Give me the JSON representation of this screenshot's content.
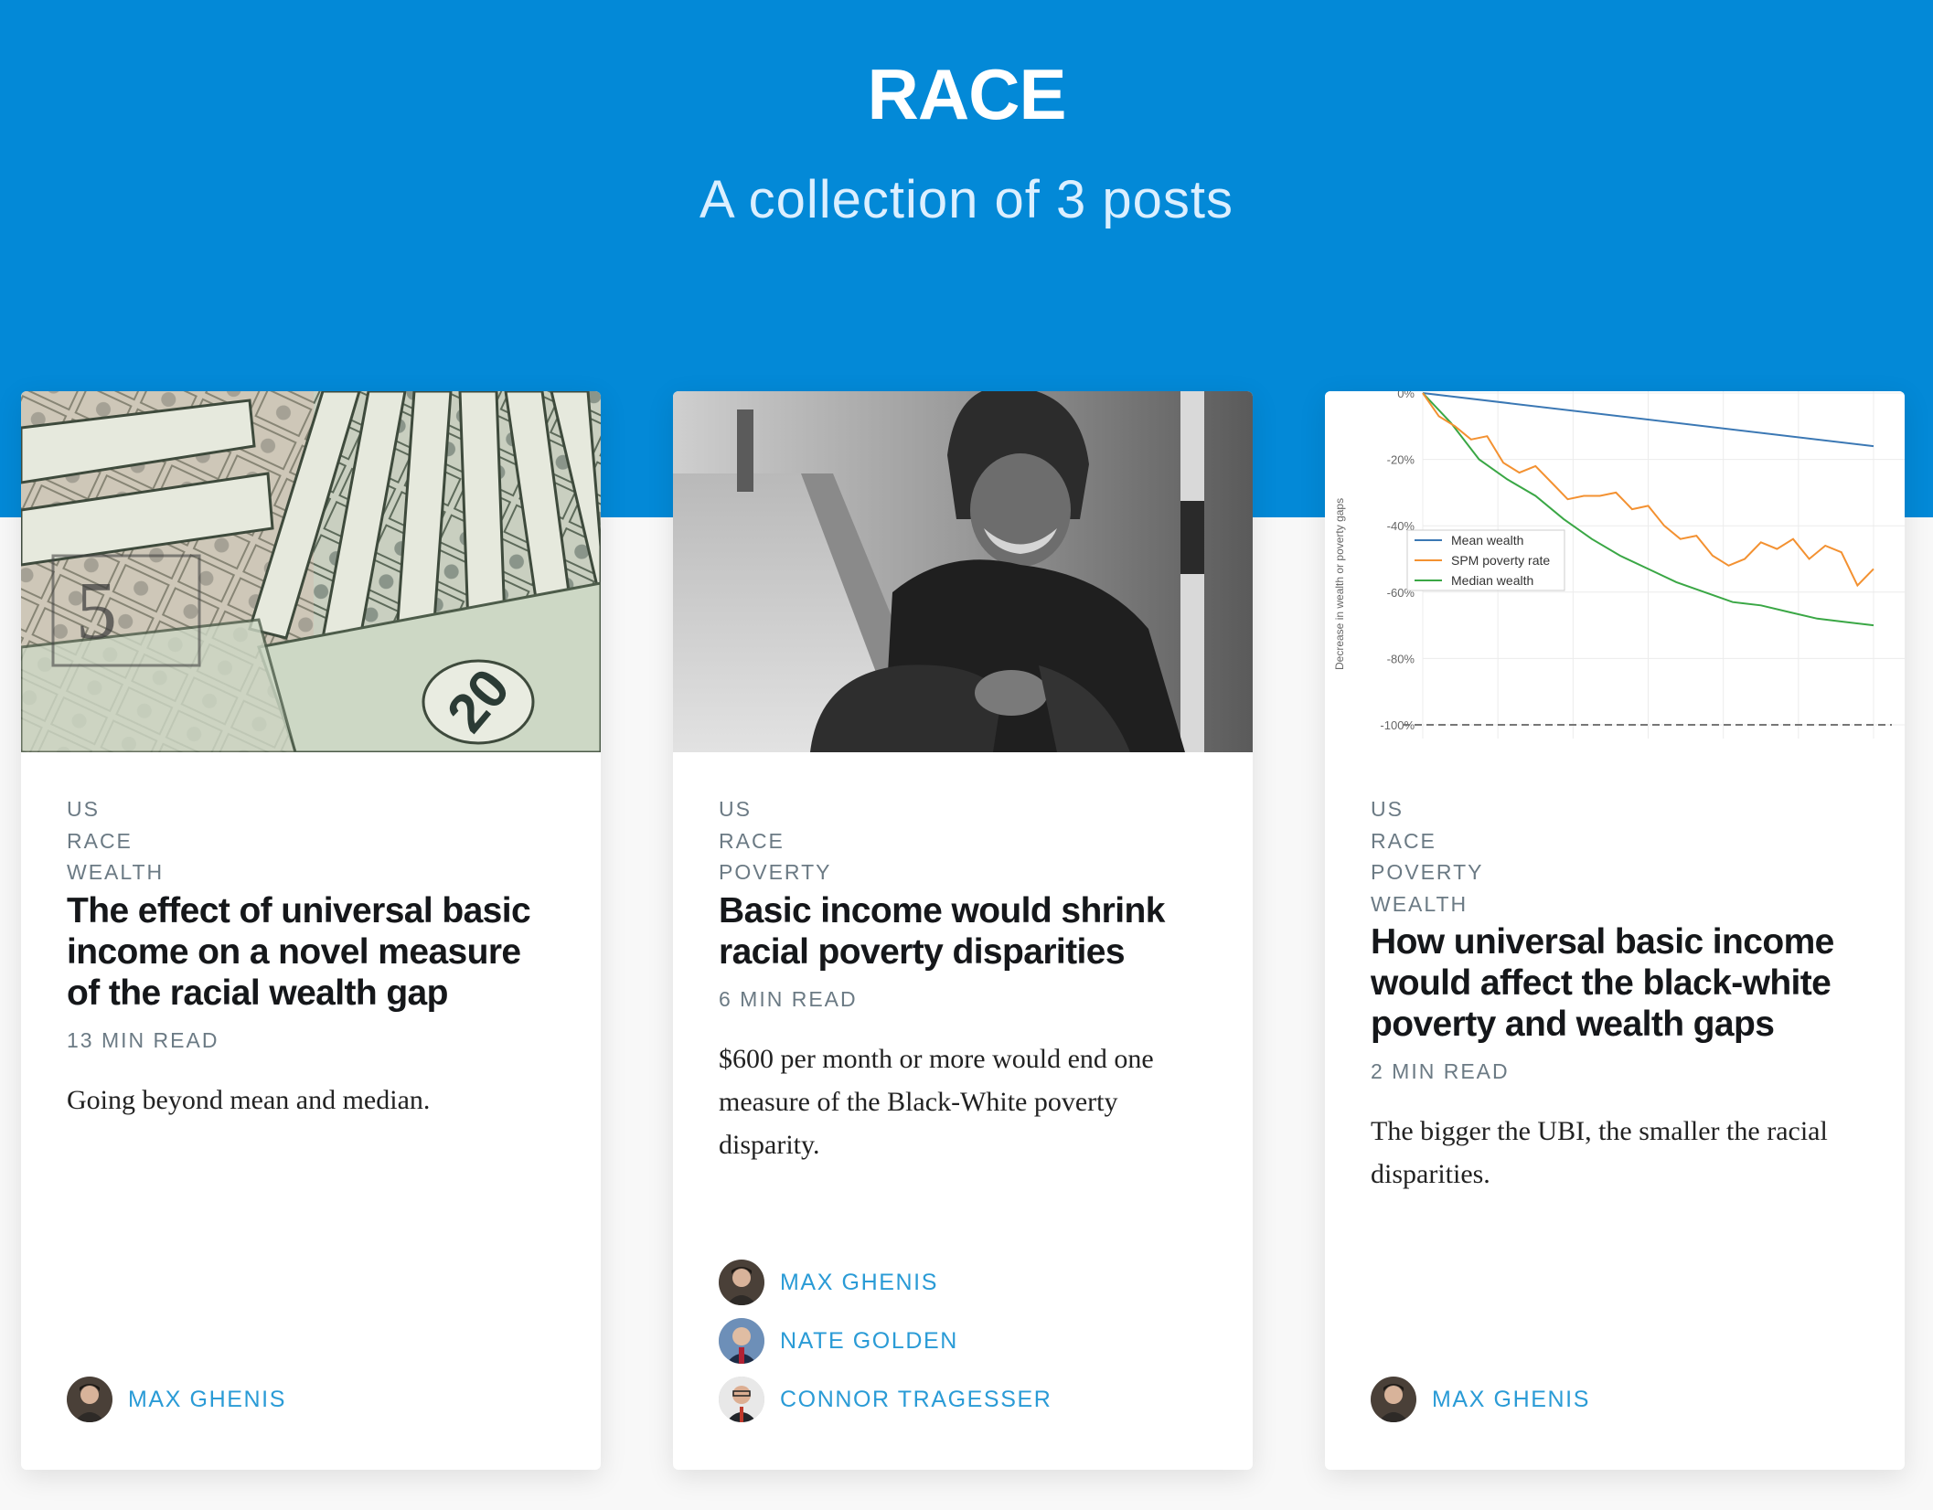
{
  "header": {
    "title": "RACE",
    "subtitle": "A collection of 3 posts"
  },
  "posts": [
    {
      "tags": [
        "US",
        "RACE",
        "WEALTH"
      ],
      "title": "The effect of universal basic income on a novel measure of the racial wealth gap",
      "read_time": "13 MIN READ",
      "excerpt": "Going beyond mean and median.",
      "image": "money-photo",
      "authors": [
        {
          "name": "MAX GHENIS"
        }
      ]
    },
    {
      "tags": [
        "US",
        "RACE",
        "POVERTY"
      ],
      "title": "Basic income would shrink racial poverty disparities",
      "read_time": "6 MIN READ",
      "excerpt": "$600 per month or more would end one measure of the Black-White poverty disparity.",
      "image": "man-sitting-photo",
      "authors": [
        {
          "name": "MAX GHENIS"
        },
        {
          "name": "NATE GOLDEN"
        },
        {
          "name": "CONNOR TRAGESSER"
        }
      ]
    },
    {
      "tags": [
        "US",
        "RACE",
        "POVERTY",
        "WEALTH"
      ],
      "title": "How universal basic income would affect the black-white poverty and wealth gaps",
      "read_time": "2 MIN READ",
      "excerpt": "The bigger the UBI, the smaller the racial disparities.",
      "image": "chart-thumbnail",
      "authors": [
        {
          "name": "MAX GHENIS"
        }
      ]
    }
  ],
  "thumb_chart": {
    "ylabel": "Decrease in wealth or poverty gaps",
    "y_ticks": [
      "0%",
      "-20%",
      "-40%",
      "-60%",
      "-80%",
      "-100%"
    ],
    "legend": [
      "Mean wealth",
      "SPM poverty rate",
      "Median wealth"
    ],
    "colors": {
      "mean": "#3b78b4",
      "spm": "#f39131",
      "median": "#3aa745",
      "ref": "#777777"
    },
    "mean_wealth": [
      0,
      -16
    ],
    "spm_poverty_rate": [
      0,
      -7,
      -10,
      -14,
      -13,
      -21,
      -24,
      -22,
      -27,
      -32,
      -31,
      -31,
      -30,
      -35,
      -34,
      -40,
      -44,
      -43,
      -49,
      -52,
      -50,
      -45,
      -47,
      -44,
      -50,
      -46,
      -48,
      -58,
      -53
    ],
    "median_wealth": [
      0,
      -9,
      -20,
      -26,
      -31,
      -38,
      -44,
      -49,
      -53,
      -57,
      -60,
      -63,
      -64,
      -66,
      -68,
      -69,
      -70
    ],
    "reference": -100
  },
  "colors": {
    "accent": "#0389d7",
    "author_link": "#2a9bd6"
  }
}
